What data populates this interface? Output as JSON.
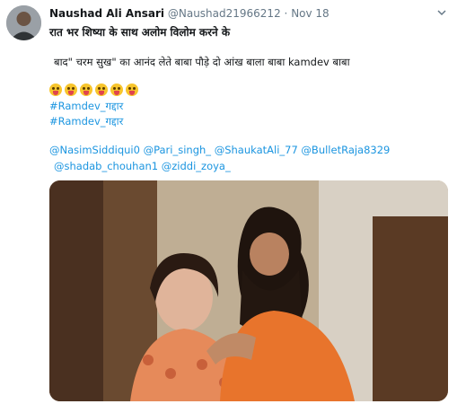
{
  "author": {
    "name": "Naushad Ali Ansari",
    "handle": "@Naushad21966212",
    "separator": "·",
    "timestamp": "Nov 18"
  },
  "tweet": {
    "line1": "रात भर शिष्या के साथ अलोम विलोम करने के",
    "line2": "बाद\" चरम सुख\" का आनंद लेते बाबा पौड़े दो आंख बाला बाबा kamdev बाबा",
    "emoji_count": 6,
    "hashtags": [
      "#Ramdev_गद्दार",
      "#Ramdev_गद्दार"
    ],
    "mentions_line1": "@NasimSiddiqui0 @Pari_singh_ @ShaukatAli_77 @BulletRaja8329",
    "mentions_line2": "@shadab_chouhan1 @ziddi_zoya_"
  },
  "colors": {
    "link": "#1b95e0",
    "secondary_text": "#657786",
    "primary_text": "#14171a"
  },
  "icons": {
    "more": "chevron-down-icon",
    "emoji": "squinting-tongue-face"
  }
}
